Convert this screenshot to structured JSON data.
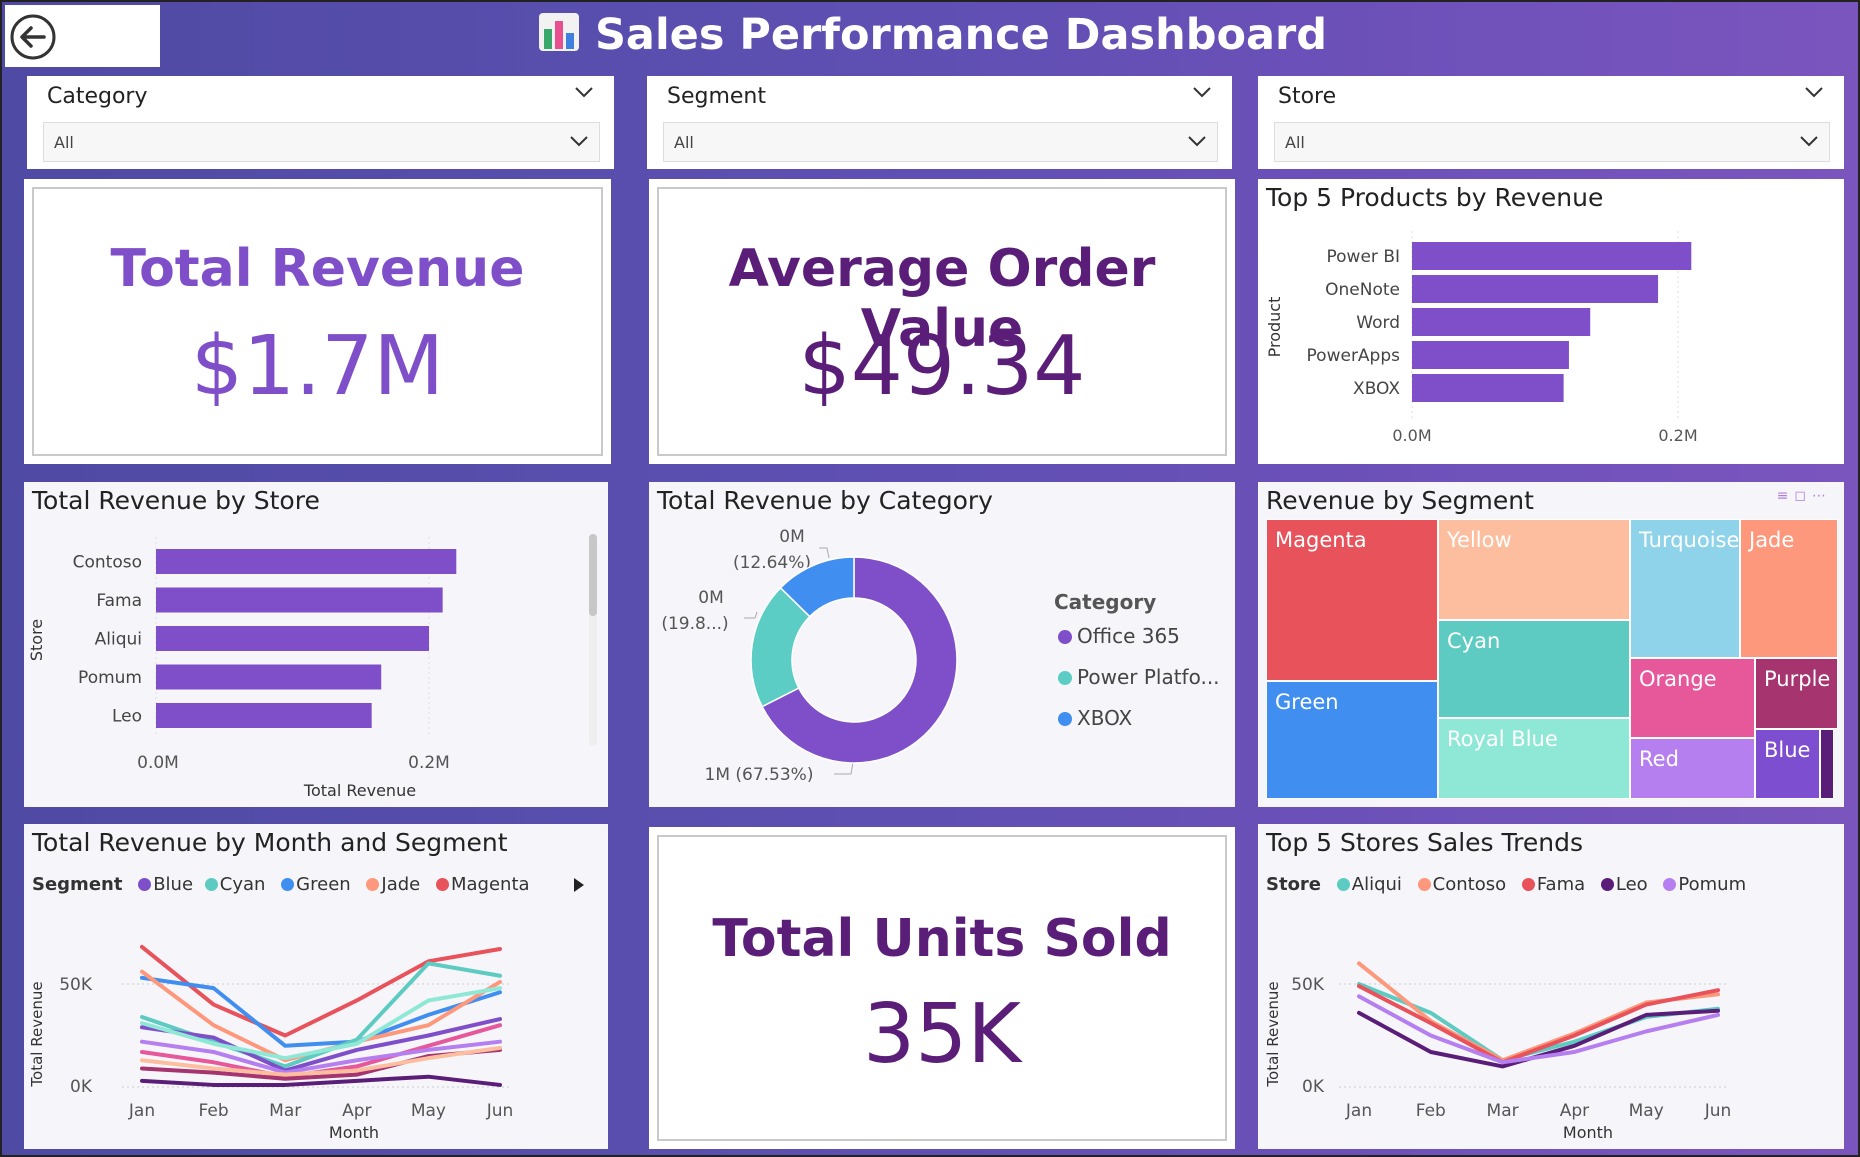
{
  "header": {
    "title": "Sales Performance Dashboard"
  },
  "slicers": [
    {
      "label": "Category",
      "value": "All"
    },
    {
      "label": "Segment",
      "value": "All"
    },
    {
      "label": "Store",
      "value": "All"
    }
  ],
  "kpis": {
    "revenue": {
      "label": "Total Revenue",
      "value": "$1.7M"
    },
    "aov": {
      "label": "Average Order Value",
      "value": "$49.34"
    },
    "units": {
      "label": "Total Units Sold",
      "value": "35K"
    }
  },
  "colors": {
    "purple": "#7e4fc8",
    "dark_purple": "#5a1d78",
    "header_bg": "#5b4fb0"
  },
  "top_products": {
    "title": "Top 5 Products by Revenue",
    "ylabel": "Product",
    "tick_labels": [
      "0.0M",
      "0.2M"
    ]
  },
  "store_revenue": {
    "title": "Total Revenue by Store",
    "ylabel": "Store",
    "xlabel": "Total Revenue",
    "tick_labels": [
      "0.0M",
      "0.2M"
    ]
  },
  "category_revenue": {
    "title": "Total Revenue by Category",
    "legend_title": "Category",
    "legend": [
      "Office 365",
      "Power Platfo...",
      "XBOX"
    ],
    "labels": [
      {
        "line1": "1M (67.53%)",
        "line2": ""
      },
      {
        "line1": "0M",
        "line2": "(19.8...)"
      },
      {
        "line1": "0M",
        "line2": "(12.64%)"
      }
    ]
  },
  "segment_treemap": {
    "title": "Revenue by Segment",
    "tiles": [
      "Magenta",
      "Green",
      "Yellow",
      "Cyan",
      "Royal Blue",
      "Turquoise",
      "Jade",
      "Orange",
      "Purple",
      "Red",
      "Blue"
    ]
  },
  "month_segment": {
    "title": "Total Revenue by Month and Segment",
    "legend_title": "Segment",
    "legend": [
      "Blue",
      "Cyan",
      "Green",
      "Jade",
      "Magenta"
    ],
    "ylabel": "Total Revenue",
    "xlabel": "Month",
    "y_ticks": [
      "50K",
      "0K"
    ]
  },
  "store_trends": {
    "title": "Top 5 Stores Sales Trends",
    "legend_title": "Store",
    "legend": [
      "Aliqui",
      "Contoso",
      "Fama",
      "Leo",
      "Pomum"
    ],
    "ylabel": "Total Revenue",
    "xlabel": "Month",
    "y_ticks": [
      "50K",
      "0K"
    ]
  },
  "chart_data": [
    {
      "type": "bar",
      "orientation": "horizontal",
      "title": "Top 5 Products by Revenue",
      "categories": [
        "Power BI",
        "OneNote",
        "Word",
        "PowerApps",
        "XBOX"
      ],
      "values": [
        0.21,
        0.185,
        0.134,
        0.118,
        0.114
      ],
      "unit": "M",
      "xlim": [
        0,
        0.2
      ]
    },
    {
      "type": "bar",
      "orientation": "horizontal",
      "title": "Total Revenue by Store",
      "categories": [
        "Contoso",
        "Fama",
        "Aliqui",
        "Pomum",
        "Leo"
      ],
      "values": [
        0.22,
        0.21,
        0.2,
        0.165,
        0.158
      ],
      "unit": "M",
      "xlabel": "Total Revenue",
      "ylabel": "Store"
    },
    {
      "type": "pie",
      "title": "Total Revenue by Category",
      "categories": [
        "Office 365",
        "Power Platfo...",
        "XBOX"
      ],
      "values": [
        67.53,
        19.83,
        12.64
      ],
      "colors": [
        "#7e4fc8",
        "#5ccdc4",
        "#3f8ef0"
      ]
    },
    {
      "type": "heatmap",
      "subtype": "treemap",
      "title": "Revenue by Segment",
      "categories": [
        "Magenta",
        "Green",
        "Yellow",
        "Cyan",
        "Royal Blue",
        "Turquoise",
        "Jade",
        "Orange",
        "Purple",
        "Red",
        "Blue"
      ],
      "colors": [
        "#e8525a",
        "#3f8ef0",
        "#fdbe9f",
        "#5ecbc2",
        "#8fe8d6",
        "#8ed3ea",
        "#fd987c",
        "#e7589b",
        "#a5346f",
        "#b57ff0",
        "#7d4ed0"
      ]
    },
    {
      "type": "line",
      "title": "Total Revenue by Month and Segment",
      "x": [
        "Jan",
        "Feb",
        "Mar",
        "Apr",
        "May",
        "Jun"
      ],
      "xlabel": "Month",
      "ylabel": "Total Revenue",
      "ylim": [
        0,
        70000
      ],
      "series": [
        {
          "name": "Magenta",
          "color": "#e8525a",
          "values": [
            68000,
            40000,
            25000,
            42000,
            61000,
            67000
          ]
        },
        {
          "name": "Green",
          "color": "#3f8ef0",
          "values": [
            53000,
            48000,
            20000,
            22000,
            35000,
            46000
          ]
        },
        {
          "name": "Jade",
          "color": "#fd987c",
          "values": [
            56000,
            30000,
            13000,
            22000,
            30000,
            51000
          ]
        },
        {
          "name": "Cyan",
          "color": "#5ecbc2",
          "values": [
            34000,
            22000,
            10000,
            23000,
            60000,
            54000
          ]
        },
        {
          "name": "Blue",
          "color": "#7e4fc8",
          "values": [
            29000,
            24000,
            8000,
            18000,
            25000,
            33000
          ]
        },
        {
          "series_extra": true,
          "color": "#8fe8d6",
          "values": [
            31000,
            21000,
            14000,
            21000,
            42000,
            48000
          ]
        },
        {
          "series_extra": true,
          "color": "#e7589b",
          "values": [
            17000,
            12000,
            5000,
            10000,
            20000,
            30000
          ]
        },
        {
          "series_extra": true,
          "color": "#b57ff0",
          "values": [
            22000,
            17000,
            7000,
            13000,
            18000,
            22000
          ]
        },
        {
          "series_extra": true,
          "color": "#a5346f",
          "values": [
            9000,
            7000,
            4000,
            6000,
            15000,
            18000
          ]
        },
        {
          "series_extra": true,
          "color": "#fdbe9f",
          "values": [
            13000,
            9000,
            6000,
            8000,
            14000,
            19000
          ]
        },
        {
          "series_extra": true,
          "color": "#5a1d78",
          "values": [
            3000,
            1000,
            1000,
            3000,
            5000,
            1000
          ]
        }
      ]
    },
    {
      "type": "line",
      "title": "Top 5 Stores Sales Trends",
      "x": [
        "Jan",
        "Feb",
        "Mar",
        "Apr",
        "May",
        "Jun"
      ],
      "xlabel": "Month",
      "ylabel": "Total Revenue",
      "ylim": [
        0,
        70000
      ],
      "series": [
        {
          "name": "Aliqui",
          "color": "#5ecbc2",
          "values": [
            50000,
            36000,
            13000,
            22000,
            34000,
            38000
          ]
        },
        {
          "name": "Contoso",
          "color": "#fd987c",
          "values": [
            60000,
            32000,
            13000,
            26000,
            41000,
            45000
          ]
        },
        {
          "name": "Fama",
          "color": "#e8525a",
          "values": [
            49000,
            31000,
            12000,
            25000,
            40000,
            47000
          ]
        },
        {
          "name": "Leo",
          "color": "#5a1d78",
          "values": [
            36000,
            17000,
            10000,
            20000,
            35000,
            37000
          ]
        },
        {
          "name": "Pomum",
          "color": "#b57ff0",
          "values": [
            44000,
            25000,
            12000,
            17000,
            27000,
            35000
          ]
        }
      ]
    }
  ]
}
